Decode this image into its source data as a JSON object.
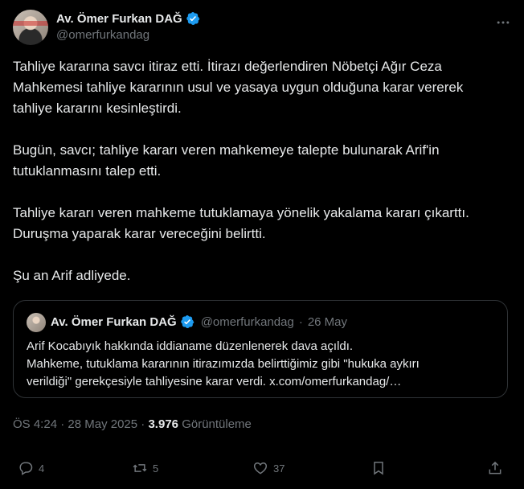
{
  "author": {
    "name": "Av. Ömer Furkan DAĞ",
    "handle": "@omerfurkandag"
  },
  "tweet": {
    "paragraphs": [
      "Tahliye kararına savcı itiraz etti. İtirazı değerlendiren Nöbetçi Ağır Ceza Mahkemesi tahliye kararının usul ve yasaya uygun olduğuna karar vererek tahliye kararını kesinleştirdi.",
      "Bugün, savcı; tahliye kararı veren mahkemeye talepte bulunarak Arif'in tutuklanmasını talep etti.",
      "Tahliye kararı veren mahkeme tutuklamaya yönelik yakalama kararı çıkarttı. Duruşma yaparak karar vereceğini belirtti.",
      "Şu an Arif adliyede."
    ]
  },
  "quoted": {
    "name": "Av. Ömer Furkan DAĞ",
    "handle": "@omerfurkandag",
    "separator": "·",
    "date": "26 May",
    "lines": [
      "Arif Kocabıyık hakkında iddianame düzenlenerek dava açıldı.",
      "Mahkeme, tutuklama kararının itirazımızda belirttiğimiz gibi \"hukuka aykırı",
      "verildiği\" gerekçesiyle tahliyesine karar verdi. x.com/omerfurkandag/…"
    ]
  },
  "meta": {
    "time": "ÖS 4:24",
    "separator": "·",
    "date": "28 May 2025",
    "views_count": "3.976",
    "views_label": "Görüntüleme"
  },
  "actions": {
    "replies": "4",
    "reposts": "5",
    "likes": "37"
  },
  "colors": {
    "background": "#000000",
    "text": "#e7e9ea",
    "muted": "#71767b",
    "verified": "#1d9bf0",
    "border": "#2f3336"
  },
  "icons": [
    "verified-badge-icon",
    "more-icon",
    "reply-icon",
    "repost-icon",
    "like-icon",
    "bookmark-icon",
    "share-icon"
  ]
}
